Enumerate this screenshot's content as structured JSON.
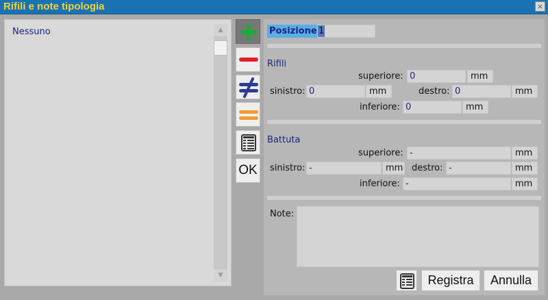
{
  "window": {
    "title": "Rifili e note tipologia",
    "close_label": "×"
  },
  "list": {
    "items": [
      "Nessuno"
    ]
  },
  "toolbar": {
    "buttons": [
      {
        "icon": "add-icon",
        "color": "#22a83a"
      },
      {
        "icon": "remove-icon",
        "color": "#e0202a"
      },
      {
        "icon": "not-equal-icon",
        "color": "#2b3c96"
      },
      {
        "icon": "equal-icon",
        "color": "#f39a2e"
      },
      {
        "icon": "table-icon",
        "color": "#333333"
      }
    ],
    "ok_label": "OK"
  },
  "position": {
    "label": "Posizione:",
    "value": "1"
  },
  "rifili": {
    "title": "Rifili",
    "superiore_label": "superiore:",
    "superiore_value": "0",
    "sinistro_label": "sinistro:",
    "sinistro_value": "0",
    "destro_label": "destro:",
    "destro_value": "0",
    "inferiore_label": "inferiore:",
    "inferiore_value": "0",
    "unit": "mm"
  },
  "battuta": {
    "title": "Battuta",
    "superiore_label": "superiore:",
    "superiore_value": "-",
    "sinistro_label": "sinistro:",
    "sinistro_value": "-",
    "destro_label": "destro:",
    "destro_value": "-",
    "inferiore_label": "inferiore:",
    "inferiore_value": "-",
    "unit": "mm"
  },
  "notes": {
    "label": "Note:",
    "value": ""
  },
  "footer": {
    "register_label": "Registra",
    "cancel_label": "Annulla"
  },
  "colors": {
    "title_bar": "#1a72b3",
    "title_text": "#f0d33a",
    "position_highlight": "#5aaee6",
    "value_text": "#1a237e"
  }
}
